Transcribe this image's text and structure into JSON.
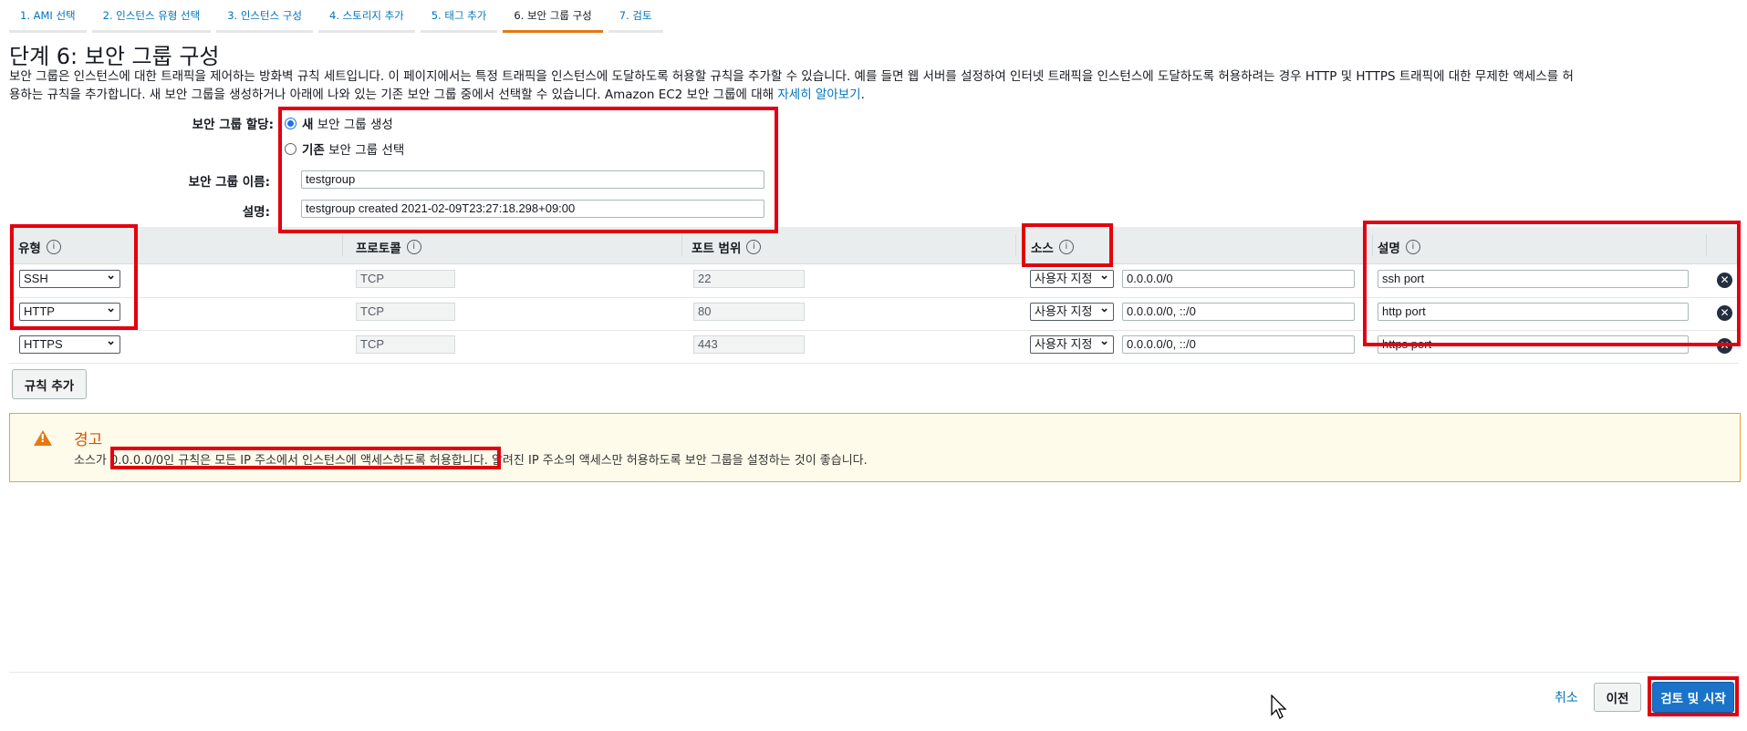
{
  "wizard": {
    "tabs": [
      "1. AMI 선택",
      "2. 인스턴스 유형 선택",
      "3. 인스턴스 구성",
      "4. 스토리지 추가",
      "5. 태그 추가",
      "6. 보안 그룹 구성",
      "7. 검토"
    ],
    "active_tab": 5
  },
  "page": {
    "title": "단계 6: 보안 그룹 구성",
    "intro_1": "보안 그룹은 인스턴스에 대한 트래픽을 제어하는 방화벽 규칙 세트입니다. 이 페이지에서는 특정 트래픽을 인스턴스에 도달하도록 허용할 규칙을 추가할 수 있습니다. 예를 들면 웹 서버를 설정하여 인터넷 트래픽을 인스턴스에 도달하도록 허용하려는 경우 HTTP 및 HTTPS 트래픽에 대한 무제한 액세스를 허",
    "intro_2": "용하는 규칙을 추가합니다. 새 보안 그룹을 생성하거나 아래에 나와 있는 기존 보안 그룹 중에서 선택할 수 있습니다. Amazon EC2 보안 그룹에 대해 ",
    "learn_more": "자세히 알아보기",
    "intro_end": "."
  },
  "assignment": {
    "label": "보안 그룹 할당:",
    "option_new_bold": "새",
    "option_new_rest": " 보안 그룹 생성",
    "option_existing_bold": "기존",
    "option_existing_rest": " 보안 그룹 선택",
    "selected": "new"
  },
  "group_form": {
    "name_label": "보안 그룹 이름:",
    "name_value": "testgroup",
    "desc_label": "설명:",
    "desc_value": "testgroup created 2021-02-09T23:27:18.298+09:00"
  },
  "table": {
    "headers": {
      "type": "유형",
      "protocol": "프로토콜",
      "port": "포트 범위",
      "source": "소스",
      "description": "설명"
    },
    "info_icon": "i",
    "rows": [
      {
        "type": "SSH",
        "protocol": "TCP",
        "port": "22",
        "source_mode": "사용자 지정",
        "source_value": "0.0.0.0/0",
        "description": "ssh port"
      },
      {
        "type": "HTTP",
        "protocol": "TCP",
        "port": "80",
        "source_mode": "사용자 지정",
        "source_value": "0.0.0.0/0, ::/0",
        "description": "http port"
      },
      {
        "type": "HTTPS",
        "protocol": "TCP",
        "port": "443",
        "source_mode": "사용자 지정",
        "source_value": "0.0.0.0/0, ::/0",
        "description": "https port"
      }
    ],
    "add_rule": "규칙 추가"
  },
  "warning": {
    "title": "경고",
    "text": "소스가 0.0.0.0/0인 규칙은 모든 IP 주소에서 인스턴스에 액세스하도록 허용합니다. 알려진 IP 주소의 액세스만 허용하도록 보안 그룹을 설정하는 것이 좋습니다.",
    "icon": "warning-triangle-icon"
  },
  "footer": {
    "cancel": "취소",
    "previous": "이전",
    "review_launch": "검토 및 시작"
  },
  "colors": {
    "accent": "#0073bb",
    "highlight": "#e3000f",
    "active_tab": "#e47911",
    "primary_button": "#1a73c8"
  }
}
